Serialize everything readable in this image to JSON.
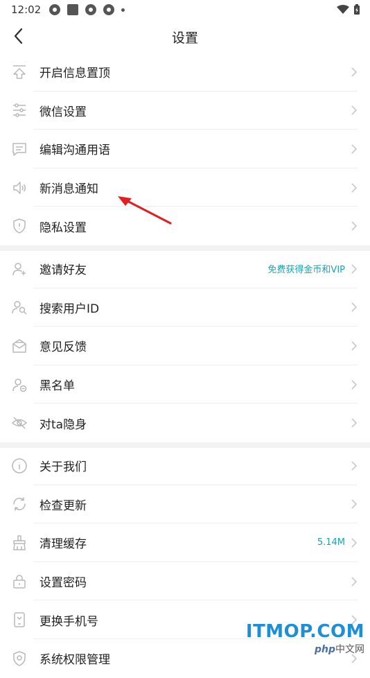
{
  "status_bar": {
    "time": "12:02"
  },
  "header": {
    "title": "设置"
  },
  "groups": [
    {
      "items": [
        {
          "label": "开启信息置顶",
          "icon": "pin-top-icon",
          "value": ""
        },
        {
          "label": "微信设置",
          "icon": "sliders-icon",
          "value": ""
        },
        {
          "label": "编辑沟通用语",
          "icon": "message-icon",
          "value": ""
        },
        {
          "label": "新消息通知",
          "icon": "speaker-icon",
          "value": ""
        },
        {
          "label": "隐私设置",
          "icon": "shield-icon",
          "value": ""
        }
      ]
    },
    {
      "items": [
        {
          "label": "邀请好友",
          "icon": "user-add-icon",
          "value": "免费获得金币和VIP"
        },
        {
          "label": "搜索用户ID",
          "icon": "user-search-icon",
          "value": ""
        },
        {
          "label": "意见反馈",
          "icon": "feedback-mail-icon",
          "value": ""
        },
        {
          "label": "黑名单",
          "icon": "user-block-icon",
          "value": ""
        },
        {
          "label": "对ta隐身",
          "icon": "eye-off-icon",
          "value": ""
        }
      ]
    },
    {
      "items": [
        {
          "label": "关于我们",
          "icon": "info-icon",
          "value": ""
        },
        {
          "label": "检查更新",
          "icon": "refresh-icon",
          "value": ""
        },
        {
          "label": "清理缓存",
          "icon": "broom-icon",
          "value": "5.14M"
        },
        {
          "label": "设置密码",
          "icon": "lock-icon",
          "value": ""
        },
        {
          "label": "更换手机号",
          "icon": "phone-icon",
          "value": ""
        },
        {
          "label": "系统权限管理",
          "icon": "permission-icon",
          "value": ""
        }
      ]
    }
  ],
  "watermark": {
    "brand": "ITMOP.COM",
    "site_php": "php",
    "site_cn": "中文网"
  },
  "colors": {
    "accent": "#1aa3b0",
    "annotation_arrow": "#e02020",
    "icon": "#b8b8b8"
  }
}
